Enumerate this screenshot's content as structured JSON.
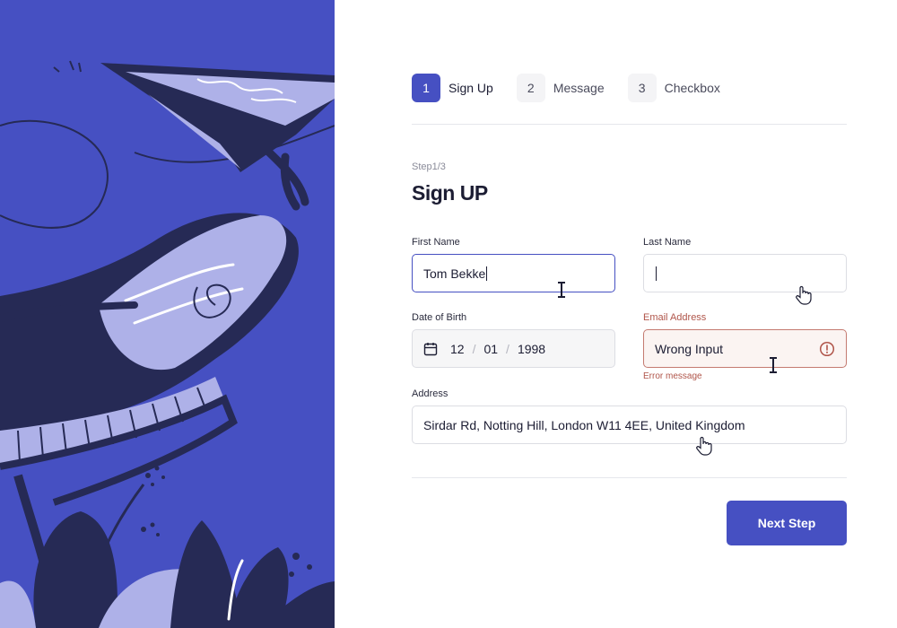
{
  "stepper": {
    "steps": [
      {
        "number": "1",
        "label": "Sign Up",
        "active": true
      },
      {
        "number": "2",
        "label": "Message",
        "active": false
      },
      {
        "number": "3",
        "label": "Checkbox",
        "active": false
      }
    ]
  },
  "form": {
    "step_count": "Step1/3",
    "title": "Sign UP",
    "first_name": {
      "label": "First Name",
      "value": "Tom Bekke"
    },
    "last_name": {
      "label": "Last Name",
      "value": ""
    },
    "date_of_birth": {
      "label": "Date of Birth",
      "day": "12",
      "month": "01",
      "year": "1998",
      "separator": "/"
    },
    "email": {
      "label": "Email Address",
      "value": "Wrong Input",
      "error": "Error message"
    },
    "address": {
      "label": "Address",
      "value": "Sirdar Rd, Notting Hill, London W11 4EE, United Kingdom"
    },
    "next_button": "Next Step"
  },
  "icons": {
    "calendar": "calendar-icon",
    "error": "alert-circle-icon",
    "text_cursor": "text-cursor-icon",
    "hand_pointer": "hand-pointer-icon"
  },
  "colors": {
    "accent": "#4650c2",
    "illustration_dark": "#262a55",
    "illustration_light": "#aeb1e8",
    "error": "#b0554a",
    "error_bg": "#fbf4f2"
  }
}
